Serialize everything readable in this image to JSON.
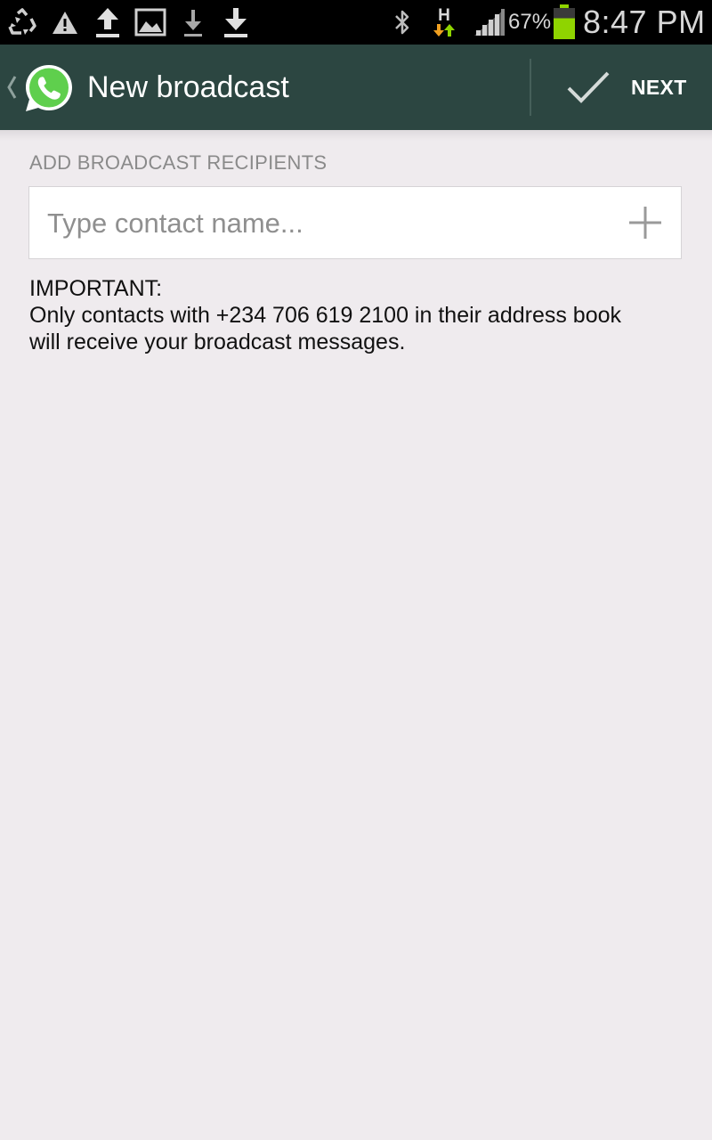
{
  "status_bar": {
    "battery_percent": "67%",
    "clock": "8:47 PM",
    "network_type": "H",
    "battery_level": 0.67,
    "icons_left": [
      "recycle-icon",
      "warning-icon",
      "upload-icon",
      "image-icon",
      "download-icon",
      "download-icon"
    ],
    "icons_right": [
      "bluetooth-icon",
      "data-activity-icon",
      "signal-icon",
      "battery-icon"
    ]
  },
  "action_bar": {
    "title": "New broadcast",
    "next_label": "NEXT",
    "icons": [
      "up-chevron-icon",
      "whatsapp-logo-icon",
      "checkmark-icon"
    ]
  },
  "content": {
    "section_label": "ADD BROADCAST RECIPIENTS",
    "contact_input": {
      "value": "",
      "placeholder": "Type contact name..."
    },
    "add_icon": "plus-icon",
    "notice_heading": "IMPORTANT:",
    "notice_line1": "Only contacts with +234 706 619 2100 in their address book",
    "notice_line2": "will receive your broadcast messages."
  },
  "colors": {
    "action_bar": "#2c4641",
    "background": "#efebee",
    "whatsapp_green": "#5fcf4d",
    "battery_green": "#8fd400",
    "status_bar": "#000000"
  }
}
